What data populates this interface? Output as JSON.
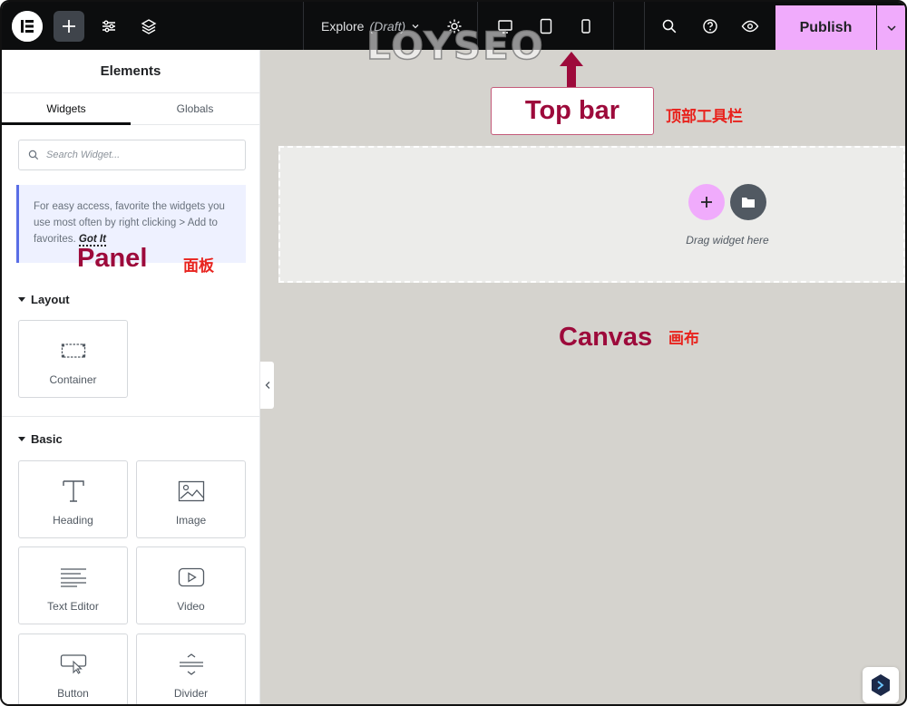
{
  "topbar": {
    "document_name": "Explore",
    "document_status": "(Draft)",
    "publish_label": "Publish"
  },
  "panel": {
    "title": "Elements",
    "tabs": [
      {
        "label": "Widgets",
        "active": true
      },
      {
        "label": "Globals",
        "active": false
      }
    ],
    "search_placeholder": "Search Widget...",
    "tip_text": "For easy access, favorite the widgets you use most often by right clicking > Add to favorites.",
    "tip_action": "Got It",
    "sections": [
      {
        "title": "Layout",
        "widgets": [
          {
            "label": "Container",
            "icon": "container-icon"
          }
        ]
      },
      {
        "title": "Basic",
        "widgets": [
          {
            "label": "Heading",
            "icon": "heading-icon"
          },
          {
            "label": "Image",
            "icon": "image-icon"
          },
          {
            "label": "Text Editor",
            "icon": "text-editor-icon"
          },
          {
            "label": "Video",
            "icon": "video-icon"
          },
          {
            "label": "Button",
            "icon": "button-icon"
          },
          {
            "label": "Divider",
            "icon": "divider-icon"
          }
        ]
      }
    ]
  },
  "canvas": {
    "drop_hint": "Drag widget here"
  },
  "annotations": {
    "top_bar_en": "Top bar",
    "top_bar_cn": "顶部工具栏",
    "panel_en": "Panel",
    "panel_cn": "面板",
    "canvas_en": "Canvas",
    "canvas_cn": "画布",
    "watermark": "LOYSEO"
  },
  "colors": {
    "topbar_bg": "#0c0d0e",
    "accent_pink": "#f0abfc",
    "canvas_bg": "#d5d3ce",
    "annotation_red": "#9d0a3b",
    "annotation_cn_red": "#e8231e"
  }
}
